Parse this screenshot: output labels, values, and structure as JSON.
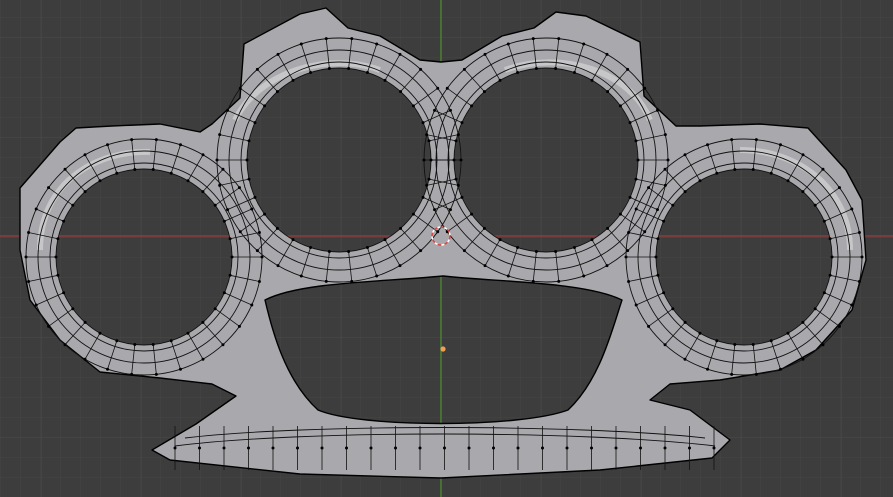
{
  "viewport": {
    "background": "#3d3d3d",
    "grid_minor": "#454545",
    "grid_major": "#4b4b4b",
    "x_axis_color": "#9b3d3d",
    "y_axis_color": "#4d8f2e"
  },
  "object": {
    "name_hint": "brass-knuckles-mesh",
    "display": "edit-mode-wireframe-on-solid",
    "fill_color": "#a9a9ad",
    "edge_color": "#000000",
    "origin_color": "#f0a050",
    "cursor_color": "#e04040",
    "finger_holes": 4,
    "selection_count": 0
  }
}
